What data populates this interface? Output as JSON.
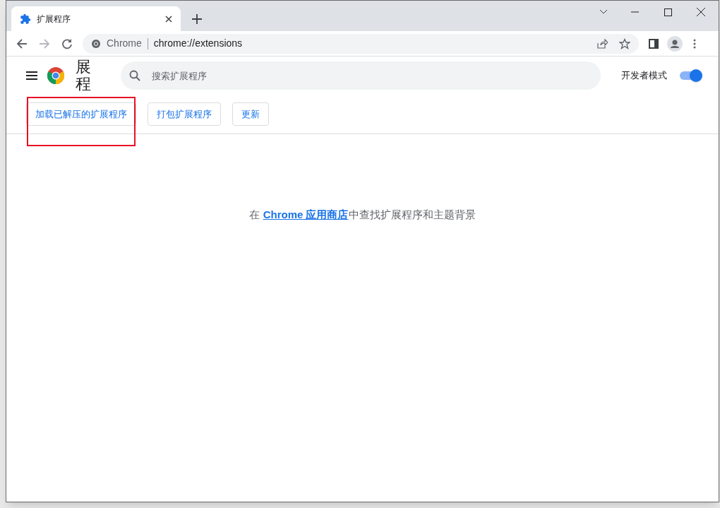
{
  "tab": {
    "title": "扩展程序",
    "selected": true
  },
  "omnibox": {
    "scheme_label": "Chrome",
    "url": "chrome://extensions"
  },
  "header": {
    "title": "展程",
    "search": {
      "placeholder": "搜索扩展程序"
    },
    "developer_mode": {
      "label": "开发者模式",
      "on": true
    }
  },
  "actions": [
    {
      "label": "加载已解压的扩展程序",
      "highlighted": true
    },
    {
      "label": "打包扩展程序",
      "highlighted": false
    },
    {
      "label": "更新",
      "highlighted": false
    }
  ],
  "empty_message": {
    "before": "在 ",
    "link": "Chrome 应用商店",
    "after": "中查找扩展程序和主题背景"
  }
}
